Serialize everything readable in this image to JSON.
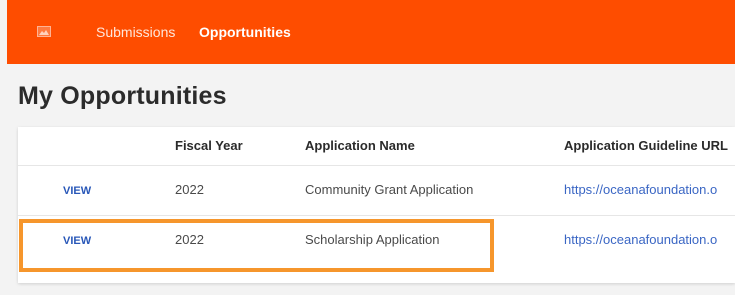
{
  "nav": {
    "logo_icon": "image-icon",
    "items": [
      {
        "label": "Submissions"
      },
      {
        "label": "Opportunities"
      }
    ]
  },
  "page_title": "My Opportunities",
  "table": {
    "columns": [
      "",
      "Fiscal Year",
      "Application Name",
      "Application Guideline URL"
    ],
    "rows": [
      {
        "action": "VIEW",
        "fiscal_year": "2022",
        "name": "Community Grant Application",
        "url": "https://oceanafoundation.o"
      },
      {
        "action": "VIEW",
        "fiscal_year": "2022",
        "name": "Scholarship Application",
        "url": "https://oceanafoundation.o"
      }
    ]
  },
  "colors": {
    "topbar": "#fe4d00",
    "highlight": "#f6962c",
    "link": "#2857b8"
  }
}
